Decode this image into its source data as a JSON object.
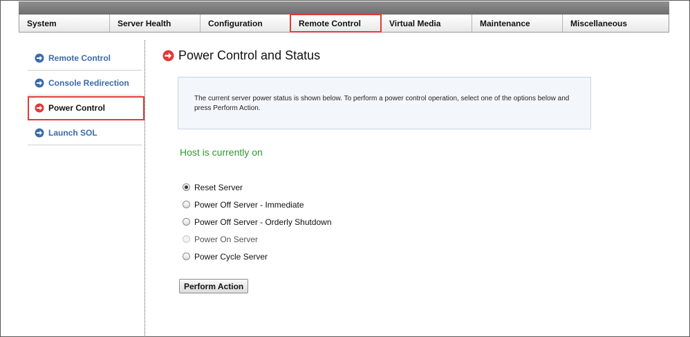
{
  "nav": {
    "tabs": [
      {
        "label": "System"
      },
      {
        "label": "Server Health"
      },
      {
        "label": "Configuration"
      },
      {
        "label": "Remote Control",
        "active": true
      },
      {
        "label": "Virtual Media"
      },
      {
        "label": "Maintenance"
      },
      {
        "label": "Miscellaneous"
      }
    ]
  },
  "sidebar": {
    "items": [
      {
        "label": "Remote Control",
        "icon": "blue-arrow-icon"
      },
      {
        "label": "Console Redirection",
        "icon": "blue-arrow-icon"
      },
      {
        "label": "Power Control",
        "icon": "red-arrow-icon",
        "active": true
      },
      {
        "label": "Launch SOL",
        "icon": "blue-arrow-icon"
      }
    ]
  },
  "main": {
    "title": "Power Control and Status",
    "info": "The current server power status is shown below. To perform a power control operation, select one of the options below and press Perform Action.",
    "status": "Host is currently on",
    "options": [
      {
        "label": "Reset Server",
        "checked": true
      },
      {
        "label": "Power Off Server - Immediate"
      },
      {
        "label": "Power Off Server - Orderly Shutdown"
      },
      {
        "label": "Power On Server",
        "disabled": true
      },
      {
        "label": "Power Cycle Server"
      }
    ],
    "action_button": "Perform Action"
  },
  "colors": {
    "accent_red": "#e03a3a",
    "link_blue": "#3a6aa8",
    "status_green": "#2e9a2e",
    "info_bg": "#f3f6fb"
  }
}
